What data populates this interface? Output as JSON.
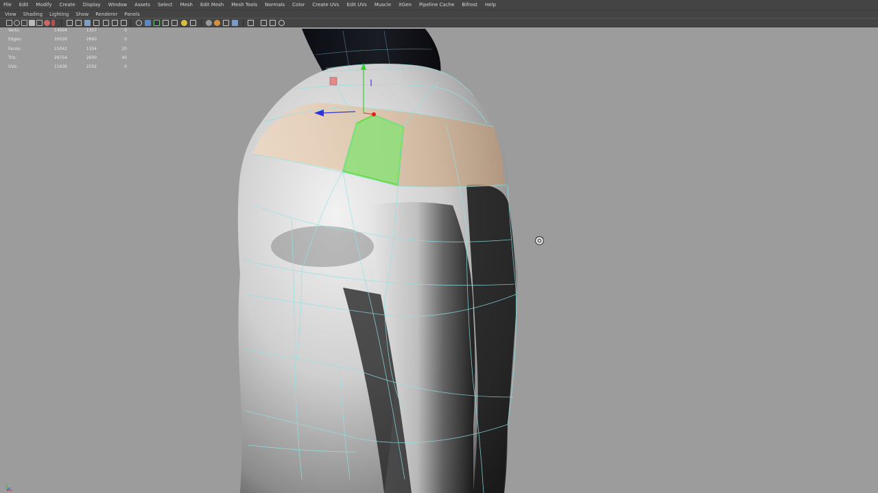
{
  "main_menu": [
    "File",
    "Edit",
    "Modify",
    "Create",
    "Display",
    "Window",
    "Assets",
    "Select",
    "Mesh",
    "Edit Mesh",
    "Mesh Tools",
    "Normals",
    "Color",
    "Create UVs",
    "Edit UVs",
    "Muscle",
    "XGen",
    "Pipeline Cache",
    "Bifrost",
    "Help"
  ],
  "panel_menu": [
    "View",
    "Shading",
    "Lighting",
    "Show",
    "Renderer",
    "Panels"
  ],
  "hud": {
    "rows": [
      {
        "label": "Verts:",
        "c1": "14994",
        "c2": "1307",
        "c3": "0"
      },
      {
        "label": "Edges:",
        "c1": "30026",
        "c2": "2660",
        "c3": "0"
      },
      {
        "label": "Faces:",
        "c1": "15042",
        "c2": "1354",
        "c3": "20"
      },
      {
        "label": "Tris:",
        "c1": "29754",
        "c2": "2600",
        "c3": "40"
      },
      {
        "label": "UVs:",
        "c1": "11636",
        "c2": "2202",
        "c3": "0"
      }
    ]
  },
  "colors": {
    "menu_bg": "#444444",
    "viewport_bg": "#9c9c9c",
    "wireframe": "#8fe3e3",
    "selected_face": "#7fd86a",
    "highlight_faces": "#e6c7a8",
    "manipulator_x": "#d03030",
    "manipulator_y": "#30d030",
    "manipulator_z": "#3030e0"
  },
  "icons": {
    "cursor": "tumble-cursor-icon",
    "axis": "view-axis-icon"
  }
}
